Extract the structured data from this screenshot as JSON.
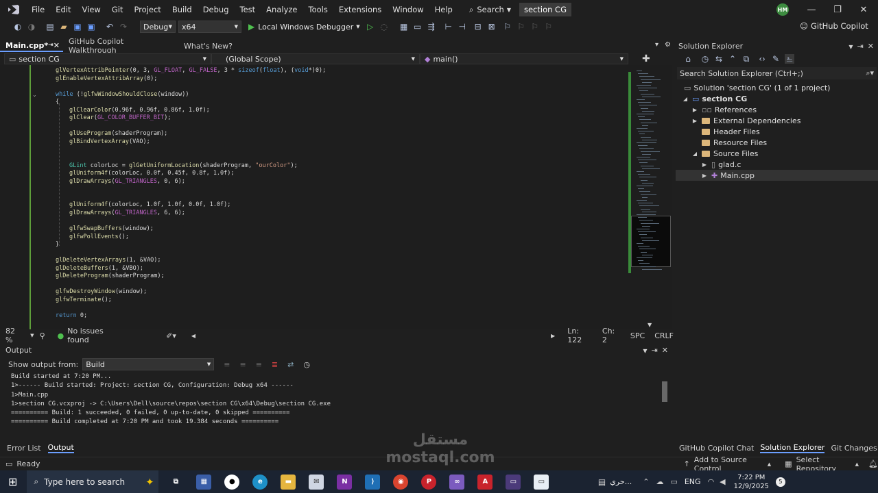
{
  "menu": [
    "File",
    "Edit",
    "View",
    "Git",
    "Project",
    "Build",
    "Debug",
    "Test",
    "Analyze",
    "Tools",
    "Extensions",
    "Window",
    "Help"
  ],
  "search_label": "Search",
  "window_title": "section CG",
  "user_initials": "HM",
  "toolbar": {
    "config": "Debug",
    "platform": "x64",
    "debugger": "Local Windows Debugger",
    "copilot": "GitHub Copilot"
  },
  "tabs": [
    "Main.cpp*",
    "GitHub Copilot Walkthrough",
    "What's New?"
  ],
  "nav": {
    "project": "section CG",
    "scope": "(Global Scope)",
    "member": "main()"
  },
  "status_editor": {
    "zoom": "82 %",
    "issues": "No issues found",
    "line": "Ln: 122",
    "col": "Ch: 2",
    "spc": "SPC",
    "crlf": "CRLF"
  },
  "output": {
    "title": "Output",
    "show_from_label": "Show output from:",
    "source": "Build",
    "lines": [
      "Build started at 7:20 PM...",
      "1>------ Build started: Project: section CG, Configuration: Debug x64 ------",
      "1>Main.cpp",
      "1>section CG.vcxproj -> C:\\Users\\Dell\\source\\repos\\section CG\\x64\\Debug\\section CG.exe",
      "========== Build: 1 succeeded, 0 failed, 0 up-to-date, 0 skipped ==========",
      "========== Build completed at 7:20 PM and took 19.384 seconds =========="
    ]
  },
  "bottom_tabs": [
    "Error List",
    "Output"
  ],
  "solution_explorer": {
    "title": "Solution Explorer",
    "search_placeholder": "Search Solution Explorer (Ctrl+;)",
    "items": [
      "Solution 'section CG' (1 of 1 project)",
      "section CG",
      "References",
      "External Dependencies",
      "Header Files",
      "Resource Files",
      "Source Files",
      "glad.c",
      "Main.cpp"
    ]
  },
  "right_tabs": [
    "GitHub Copilot Chat",
    "Solution Explorer",
    "Git Changes"
  ],
  "statusbar": {
    "ready": "Ready",
    "source_control": "Add to Source Control",
    "repo": "Select Repository"
  },
  "taskbar": {
    "search": "Type here to search",
    "lang_ar": "حري...",
    "lang": "ENG",
    "time": "7:22 PM",
    "date": "12/9/2025",
    "notif": "5"
  },
  "watermark": "مستقل mostaql.com",
  "colors": {
    "accent": "#6b9eff",
    "green": "#4fc04f",
    "editor_bg": "#1e1e1e"
  },
  "code_lines": [
    {
      "indent": 0,
      "tokens": [
        [
          "fn",
          "glVertexAttribPointer"
        ],
        [
          "p",
          "(0, 3, "
        ],
        [
          "mac",
          "GL_FLOAT"
        ],
        [
          "p",
          ", "
        ],
        [
          "mac",
          "GL_FALSE"
        ],
        [
          "p",
          ", 3 * "
        ],
        [
          "kw",
          "sizeof"
        ],
        [
          "p",
          "("
        ],
        [
          "kw",
          "float"
        ],
        [
          "p",
          "), ("
        ],
        [
          "kw",
          "void"
        ],
        [
          "p",
          "*)0);"
        ]
      ]
    },
    {
      "indent": 0,
      "tokens": [
        [
          "fn",
          "glEnableVertexAttribArray"
        ],
        [
          "p",
          "(0);"
        ]
      ]
    },
    {
      "indent": 0,
      "tokens": []
    },
    {
      "indent": 0,
      "tokens": [
        [
          "kw",
          "while"
        ],
        [
          "p",
          " (!"
        ],
        [
          "fn",
          "glfwWindowShouldClose"
        ],
        [
          "p",
          "(window))"
        ]
      ]
    },
    {
      "indent": 0,
      "tokens": [
        [
          "p",
          "{"
        ]
      ]
    },
    {
      "indent": 1,
      "tokens": [
        [
          "fn",
          "glClearColor"
        ],
        [
          "p",
          "(0.96f, 0.96f, 0.86f, 1.0f);"
        ]
      ]
    },
    {
      "indent": 1,
      "tokens": [
        [
          "fn",
          "glClear"
        ],
        [
          "p",
          "("
        ],
        [
          "mac",
          "GL_COLOR_BUFFER_BIT"
        ],
        [
          "p",
          ");"
        ]
      ]
    },
    {
      "indent": 0,
      "tokens": []
    },
    {
      "indent": 1,
      "tokens": [
        [
          "fn",
          "glUseProgram"
        ],
        [
          "p",
          "(shaderProgram);"
        ]
      ]
    },
    {
      "indent": 1,
      "tokens": [
        [
          "fn",
          "glBindVertexArray"
        ],
        [
          "p",
          "(VAO);"
        ]
      ]
    },
    {
      "indent": 0,
      "tokens": []
    },
    {
      "indent": 0,
      "tokens": []
    },
    {
      "indent": 1,
      "tokens": [
        [
          "ty",
          "GLint"
        ],
        [
          "p",
          " colorLoc = "
        ],
        [
          "fn",
          "glGetUniformLocation"
        ],
        [
          "p",
          "(shaderProgram, "
        ],
        [
          "st",
          "\"ourColor\""
        ],
        [
          "p",
          ");"
        ]
      ]
    },
    {
      "indent": 1,
      "tokens": [
        [
          "fn",
          "glUniform4f"
        ],
        [
          "p",
          "(colorLoc, 0.0f, 0.45f, 0.8f, 1.0f);"
        ]
      ]
    },
    {
      "indent": 1,
      "tokens": [
        [
          "fn",
          "glDrawArrays"
        ],
        [
          "p",
          "("
        ],
        [
          "mac",
          "GL_TRIANGLES"
        ],
        [
          "p",
          ", 0, 6);"
        ]
      ]
    },
    {
      "indent": 0,
      "tokens": []
    },
    {
      "indent": 0,
      "tokens": []
    },
    {
      "indent": 1,
      "tokens": [
        [
          "fn",
          "glUniform4f"
        ],
        [
          "p",
          "(colorLoc, 1.0f, 1.0f, 0.0f, 1.0f);"
        ]
      ]
    },
    {
      "indent": 1,
      "tokens": [
        [
          "fn",
          "glDrawArrays"
        ],
        [
          "p",
          "("
        ],
        [
          "mac",
          "GL_TRIANGLES"
        ],
        [
          "p",
          ", 6, 6);"
        ]
      ]
    },
    {
      "indent": 0,
      "tokens": []
    },
    {
      "indent": 1,
      "tokens": [
        [
          "fn",
          "glfwSwapBuffers"
        ],
        [
          "p",
          "(window);"
        ]
      ]
    },
    {
      "indent": 1,
      "tokens": [
        [
          "fn",
          "glfwPollEvents"
        ],
        [
          "p",
          "();"
        ]
      ]
    },
    {
      "indent": 0,
      "tokens": [
        [
          "p",
          "}"
        ]
      ]
    },
    {
      "indent": 0,
      "tokens": []
    },
    {
      "indent": 0,
      "tokens": [
        [
          "fn",
          "glDeleteVertexArrays"
        ],
        [
          "p",
          "(1, &VAO);"
        ]
      ]
    },
    {
      "indent": 0,
      "tokens": [
        [
          "fn",
          "glDeleteBuffers"
        ],
        [
          "p",
          "(1, &VBO);"
        ]
      ]
    },
    {
      "indent": 0,
      "tokens": [
        [
          "fn",
          "glDeleteProgram"
        ],
        [
          "p",
          "(shaderProgram);"
        ]
      ]
    },
    {
      "indent": 0,
      "tokens": []
    },
    {
      "indent": 0,
      "tokens": [
        [
          "fn",
          "glfwDestroyWindow"
        ],
        [
          "p",
          "(window);"
        ]
      ]
    },
    {
      "indent": 0,
      "tokens": [
        [
          "fn",
          "glfwTerminate"
        ],
        [
          "p",
          "();"
        ]
      ]
    },
    {
      "indent": 0,
      "tokens": []
    },
    {
      "indent": 0,
      "tokens": [
        [
          "kw",
          "return"
        ],
        [
          "p",
          " 0;"
        ]
      ]
    }
  ]
}
